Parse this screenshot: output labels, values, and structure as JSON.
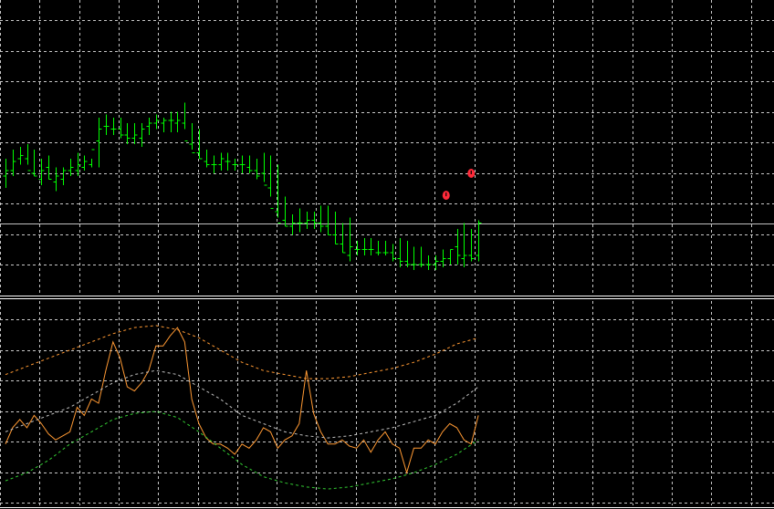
{
  "colors": {
    "background": "#000000",
    "grid": "#c8c8c8",
    "bar": "#00ff00",
    "current_price_line": "#c0c0c0",
    "separator": "#ffffff",
    "oscillator": "#ff9933",
    "upper_band": "#ff9933",
    "middle_band": "#bfbfbf",
    "lower_band": "#33cc33",
    "signal_marker": "#ff2a3a"
  },
  "chart_data": [
    {
      "type": "ohlc",
      "panel": "main-price",
      "grid": true,
      "ylim": [
        0,
        10
      ],
      "current_price": 2.4,
      "x": [
        0,
        1,
        2,
        3,
        4,
        5,
        6,
        7,
        8,
        9,
        10,
        11,
        12,
        13,
        14,
        15,
        16,
        17,
        18,
        19,
        20,
        21,
        22,
        23,
        24,
        25,
        26,
        27,
        28,
        29,
        30,
        31,
        32,
        33,
        34,
        35,
        36,
        37,
        38,
        39,
        40,
        41,
        42,
        43,
        44,
        45,
        46,
        47,
        48,
        49,
        50,
        51,
        52,
        53,
        54,
        55,
        56,
        57,
        58,
        59,
        60,
        61,
        62,
        63,
        64,
        65,
        66
      ],
      "high": [
        4.6,
        4.9,
        5.0,
        5.1,
        4.9,
        4.6,
        4.7,
        4.3,
        4.3,
        4.6,
        4.8,
        4.7,
        4.6,
        6.0,
        6.1,
        6.0,
        6.0,
        5.8,
        5.8,
        5.8,
        6.0,
        6.1,
        6.0,
        6.2,
        6.2,
        6.5,
        5.8,
        5.6,
        4.9,
        4.7,
        4.8,
        4.8,
        4.6,
        4.7,
        4.7,
        4.6,
        4.8,
        4.7,
        4.4,
        3.3,
        2.7,
        2.9,
        2.8,
        2.8,
        3.0,
        3.0,
        2.8,
        2.4,
        2.6,
        1.8,
        1.9,
        1.9,
        1.8,
        1.8,
        1.7,
        1.9,
        1.8,
        1.6,
        1.6,
        1.3,
        1.3,
        1.5,
        1.5,
        2.2,
        2.4,
        2.2,
        2.5
      ],
      "low": [
        3.6,
        4.0,
        4.4,
        4.4,
        4.0,
        3.7,
        3.9,
        3.5,
        3.7,
        4.0,
        4.0,
        4.2,
        4.3,
        4.3,
        5.4,
        5.4,
        5.3,
        5.1,
        5.1,
        5.0,
        5.4,
        5.6,
        5.5,
        5.5,
        5.5,
        5.6,
        4.9,
        4.6,
        4.3,
        4.1,
        4.2,
        4.2,
        4.2,
        4.1,
        4.1,
        3.9,
        3.8,
        3.3,
        2.6,
        2.3,
        2.0,
        2.1,
        2.2,
        2.2,
        2.1,
        2.0,
        1.7,
        1.4,
        1.1,
        1.3,
        1.3,
        1.3,
        1.3,
        1.3,
        1.1,
        0.9,
        0.9,
        0.8,
        0.9,
        0.8,
        0.8,
        0.9,
        1.0,
        1.0,
        0.9,
        1.1,
        1.1
      ],
      "open": [
        4.0,
        4.2,
        4.6,
        4.6,
        4.1,
        3.9,
        4.3,
        3.8,
        3.9,
        4.2,
        4.2,
        4.3,
        4.4,
        5.2,
        5.7,
        5.6,
        5.6,
        5.4,
        5.3,
        5.3,
        5.7,
        5.8,
        5.8,
        5.9,
        5.8,
        5.8,
        5.1,
        4.8,
        4.5,
        4.4,
        4.4,
        4.5,
        4.4,
        4.4,
        4.3,
        4.2,
        4.1,
        3.6,
        2.8,
        2.5,
        2.3,
        2.4,
        2.4,
        2.5,
        2.4,
        2.3,
        2.0,
        1.7,
        1.3,
        1.5,
        1.5,
        1.5,
        1.4,
        1.4,
        1.4,
        1.2,
        1.1,
        1.0,
        1.0,
        1.0,
        1.0,
        1.1,
        1.2,
        1.6,
        1.2,
        1.3,
        1.3
      ],
      "close": [
        4.2,
        4.5,
        4.7,
        4.2,
        4.0,
        4.2,
        3.9,
        4.0,
        4.2,
        4.3,
        4.4,
        4.5,
        4.9,
        5.6,
        5.7,
        5.6,
        5.4,
        5.3,
        5.4,
        5.6,
        5.8,
        5.9,
        5.9,
        5.9,
        5.9,
        5.2,
        4.8,
        4.6,
        4.4,
        4.4,
        4.6,
        4.5,
        4.4,
        4.4,
        4.2,
        4.0,
        3.7,
        2.9,
        2.4,
        2.3,
        2.4,
        2.4,
        2.5,
        2.4,
        2.3,
        2.0,
        1.7,
        1.4,
        1.6,
        1.5,
        1.5,
        1.5,
        1.4,
        1.4,
        1.2,
        1.1,
        1.0,
        1.0,
        1.0,
        1.0,
        1.1,
        1.2,
        1.5,
        1.3,
        1.3,
        1.2,
        2.4
      ]
    },
    {
      "type": "line",
      "panel": "indicator",
      "grid": true,
      "ylim": [
        0,
        100
      ],
      "signal_markers": [
        {
          "x": 61.5,
          "price": 3.35
        },
        {
          "x": 65,
          "price": 4.1
        }
      ],
      "series": [
        {
          "role": "oscillator",
          "style": "solid",
          "x": [
            0,
            1,
            2,
            3,
            4,
            5,
            6,
            7,
            8,
            9,
            10,
            11,
            12,
            13,
            14,
            15,
            16,
            17,
            18,
            19,
            20,
            21,
            22,
            23,
            24,
            25,
            26,
            27,
            28,
            29,
            30,
            31,
            32,
            33,
            34,
            35,
            36,
            37,
            38,
            39,
            40,
            41,
            42,
            43,
            44,
            45,
            46,
            47,
            48,
            49,
            50,
            51,
            52,
            53,
            54,
            55,
            56,
            57,
            58,
            59,
            60,
            61,
            62,
            63,
            64,
            65,
            66
          ],
          "y": [
            30,
            38,
            42,
            38,
            44,
            40,
            35,
            32,
            34,
            36,
            48,
            44,
            52,
            50,
            66,
            80,
            72,
            58,
            56,
            60,
            66,
            78,
            78,
            83,
            87,
            80,
            52,
            40,
            33,
            30,
            30,
            28,
            25,
            30,
            28,
            32,
            38,
            36,
            28,
            32,
            34,
            40,
            66,
            45,
            36,
            30,
            30,
            32,
            29,
            28,
            32,
            26,
            32,
            36,
            30,
            28,
            16,
            28,
            28,
            32,
            30,
            36,
            40,
            38,
            32,
            30,
            44
          ]
        },
        {
          "role": "upper-band",
          "style": "dashed",
          "x": [
            0,
            3,
            6,
            9,
            12,
            15,
            18,
            21,
            24,
            27,
            30,
            33,
            36,
            39,
            42,
            45,
            48,
            51,
            54,
            57,
            60,
            63,
            66
          ],
          "y": [
            64,
            68,
            72,
            76,
            80,
            84,
            87,
            88,
            86,
            82,
            76,
            70,
            66,
            64,
            62,
            62,
            63,
            65,
            67,
            70,
            74,
            79,
            82
          ]
        },
        {
          "role": "middle-band",
          "style": "dashed",
          "x": [
            0,
            3,
            6,
            9,
            12,
            15,
            18,
            21,
            24,
            27,
            30,
            33,
            36,
            39,
            42,
            45,
            48,
            51,
            54,
            57,
            60,
            63,
            66
          ],
          "y": [
            36,
            40,
            44,
            48,
            54,
            60,
            64,
            66,
            64,
            58,
            52,
            44,
            40,
            36,
            34,
            33,
            34,
            36,
            38,
            41,
            44,
            50,
            58
          ]
        },
        {
          "role": "lower-band",
          "style": "dashed",
          "x": [
            0,
            3,
            6,
            9,
            12,
            15,
            18,
            21,
            24,
            27,
            30,
            33,
            36,
            39,
            42,
            45,
            48,
            51,
            54,
            57,
            60,
            63,
            66
          ],
          "y": [
            12,
            16,
            22,
            30,
            36,
            42,
            45,
            46,
            43,
            36,
            28,
            20,
            14,
            11,
            9,
            8,
            9,
            11,
            13,
            16,
            20,
            25,
            32
          ]
        }
      ]
    }
  ]
}
